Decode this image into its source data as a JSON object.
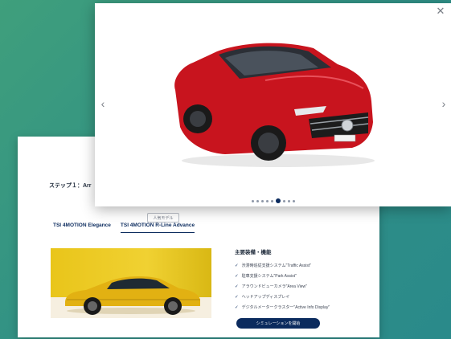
{
  "configurator": {
    "step_title": "ステップ１：Arr",
    "model_tag": "人気モデル",
    "grades": [
      {
        "label": "TSI 4MOTION Elegance",
        "active": false
      },
      {
        "label": "TSI 4MOTION R-Line Advance",
        "active": true
      }
    ],
    "features_title": "主要装備・機能",
    "features": [
      "渋滞時追従支援システム\"Traffic Assist\"",
      "駐車支援システム\"Park Assist\"",
      "アラウンドビューカメラ\"Area View\"",
      "ヘッドアップディスプレイ",
      "デジタルメータークラスター\"Active Info Display\""
    ],
    "simulation_button": "シミュレーションを開始"
  },
  "lightbox": {
    "close_icon": "close-icon",
    "prev_icon": "chevron-left-icon",
    "next_icon": "chevron-right-icon",
    "dot_count": 9,
    "active_dot": 5
  },
  "colors": {
    "navy": "#0b2b5e",
    "car_red": "#c8141e",
    "car_yellow": "#e2b112",
    "background_green": "#3f9f7c"
  }
}
